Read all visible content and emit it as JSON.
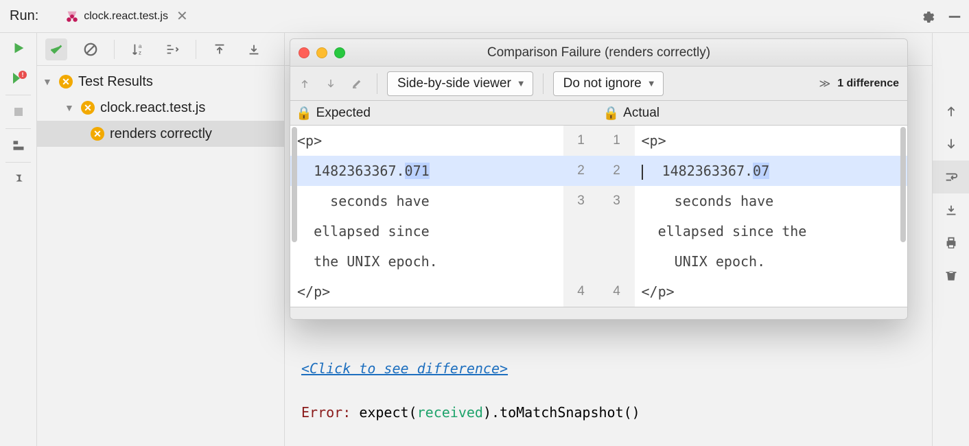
{
  "run_label": "Run:",
  "tab_name": "clock.react.test.js",
  "tree": {
    "root": "Test Results",
    "file": "clock.react.test.js",
    "test": "renders correctly"
  },
  "console": {
    "link_text": "<Click to see difference>",
    "error_prefix": "Error",
    "error_sep": ": ",
    "expr_1": "expect(",
    "expr_received": "received",
    "expr_2": ")",
    "expr_match": ".toMatchSnapshot",
    "expr_3": "()"
  },
  "dialog": {
    "title": "Comparison Failure (renders correctly)",
    "view_mode": "Side-by-side viewer",
    "ignore_mode": "Do not ignore",
    "diff_count": "1 difference",
    "expected_label": "Expected",
    "actual_label": "Actual",
    "expected_lines": [
      "<p>",
      "  1482363367.",
      "    seconds have",
      "  ellapsed since",
      "  the UNIX epoch.",
      "</p>"
    ],
    "expected_diff_frag": "071",
    "actual_lines": [
      "<p>",
      "  1482363367.",
      "    seconds have",
      "  ellapsed since the",
      "    UNIX epoch.",
      "</p>"
    ],
    "actual_diff_frag": "07",
    "gutter_left": [
      "1",
      "2",
      "3",
      "",
      "",
      "4"
    ],
    "gutter_right": [
      "1",
      "2",
      "3",
      "",
      "",
      "4"
    ]
  },
  "icons": {
    "gear": "gear-icon",
    "minimize": "minimize-icon"
  }
}
